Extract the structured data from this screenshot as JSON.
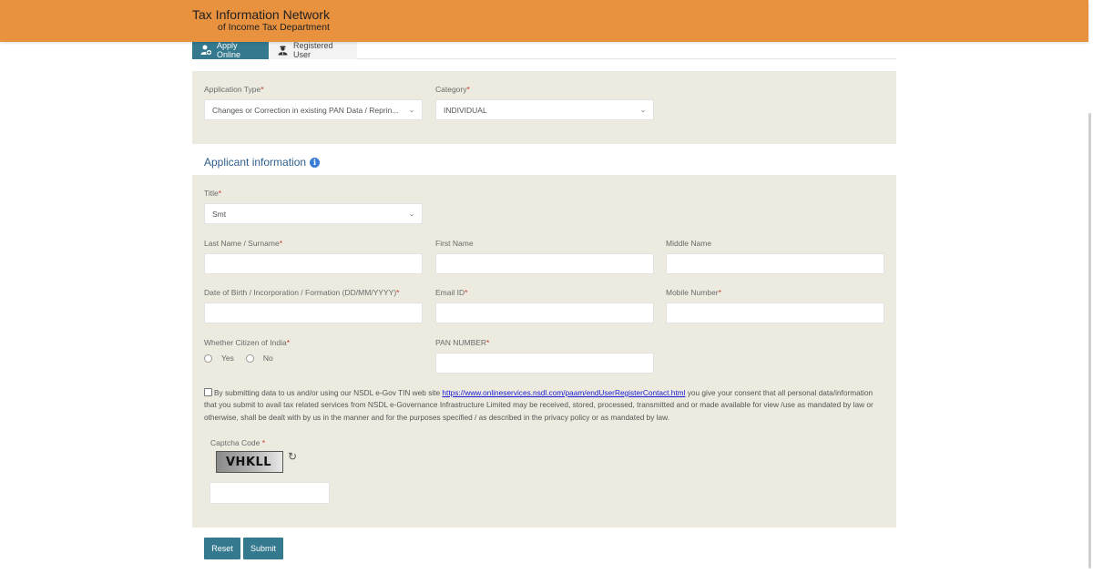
{
  "header": {
    "title": "Tax Information Network",
    "subtitle": "of Income Tax Department"
  },
  "tabs": [
    {
      "label": "Apply Online",
      "icon": "user-add-icon",
      "active": true
    },
    {
      "label": "Registered User",
      "icon": "user-icon",
      "active": false
    }
  ],
  "application": {
    "type": {
      "label": "Application Type",
      "required_mark": "*",
      "value": "Changes or Correction in existing PAN Data / Reprin..."
    },
    "category": {
      "label": "Category",
      "required_mark": "*",
      "value": "INDIVIDUAL"
    }
  },
  "applicant": {
    "section_title": "Applicant information",
    "info_icon_glyph": "i",
    "title": {
      "label": "Title",
      "required_mark": "*",
      "value": "Smt"
    },
    "last_name": {
      "label": "Last Name / Surname",
      "required_mark": "*",
      "value": ""
    },
    "first_name": {
      "label": "First Name",
      "value": ""
    },
    "middle_name": {
      "label": "Middle Name",
      "value": ""
    },
    "dob": {
      "label": "Date of Birth / Incorporation / Formation (DD/MM/YYYY)",
      "required_mark": "*",
      "value": ""
    },
    "email": {
      "label": "Email ID",
      "required_mark": "*",
      "value": ""
    },
    "mobile": {
      "label": "Mobile Number",
      "required_mark": "*",
      "value": ""
    },
    "citizen": {
      "label": "Whether Citizen of India",
      "required_mark": "*",
      "options": [
        "Yes",
        "No"
      ],
      "selected": null
    },
    "pan": {
      "label": "PAN NUMBER",
      "required_mark": "*",
      "value": ""
    }
  },
  "consent": {
    "checked": false,
    "text_before": "By submitting data to us and/or using our NSDL e-Gov TIN web site ",
    "link": "https://www.onlineservices.nsdl.com/paam/endUserRegisterContact.html",
    "text_after": " you give your consent that all personal data/information that you submit to avail tax related services from NSDL e-Governance Infrastructure Limited may be received, stored, processed, transmitted and or made available for view /use as mandated by law or otherwise, shall be dealt with by us in the manner and for the purposes specified / as described in the privacy policy or as mandated by law."
  },
  "captcha": {
    "label": "Captcha Code",
    "required_mark": "*",
    "code": "VHKLL",
    "refresh_glyph": "↻",
    "input_value": ""
  },
  "buttons": {
    "reset": "Reset",
    "submit": "Submit"
  },
  "colors": {
    "header": "#e8923f",
    "accent": "#35798e",
    "panel": "#edebdf",
    "link": "#1a1ad6"
  },
  "chevron_glyph": "⌄"
}
